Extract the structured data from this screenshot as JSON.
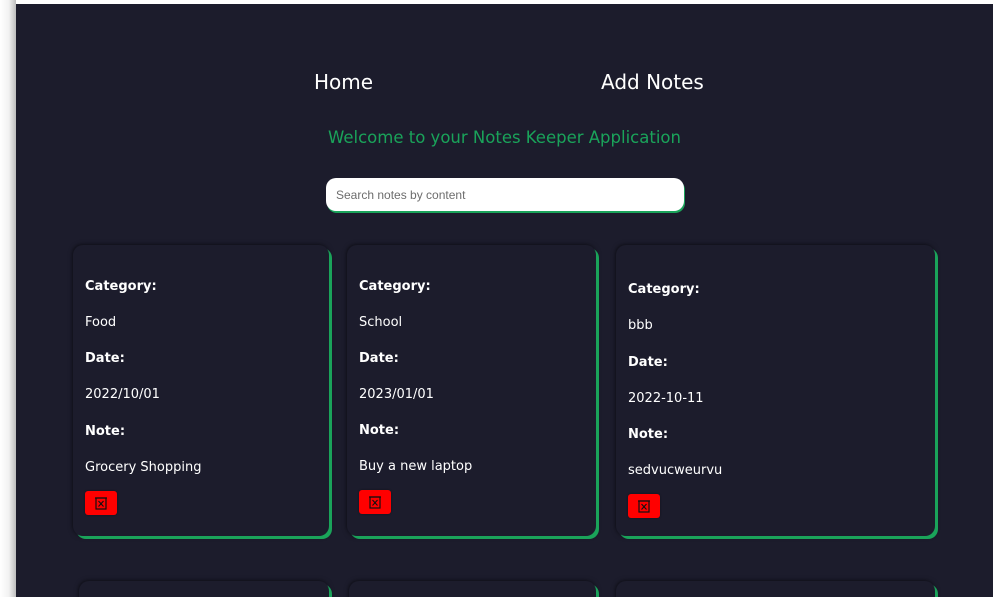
{
  "nav": {
    "home_label": "Home",
    "add_notes_label": "Add Notes"
  },
  "welcome_text": "Welcome to your Notes Keeper Application",
  "search": {
    "placeholder": "Search notes by content",
    "value": ""
  },
  "labels": {
    "category": "Category:",
    "date": "Date:",
    "note": "Note:"
  },
  "notes": [
    {
      "category": "Food",
      "date": "2022/10/01",
      "note": "Grocery Shopping"
    },
    {
      "category": "School",
      "date": "2023/01/01",
      "note": "Buy a new laptop"
    },
    {
      "category": "bbb",
      "date": "2022-10-11",
      "note": "sedvucweurvu"
    }
  ],
  "colors": {
    "background": "#1c1c2c",
    "accent": "#1aa35a",
    "delete": "#ff0000"
  },
  "icons": {
    "delete": "trash-icon"
  }
}
